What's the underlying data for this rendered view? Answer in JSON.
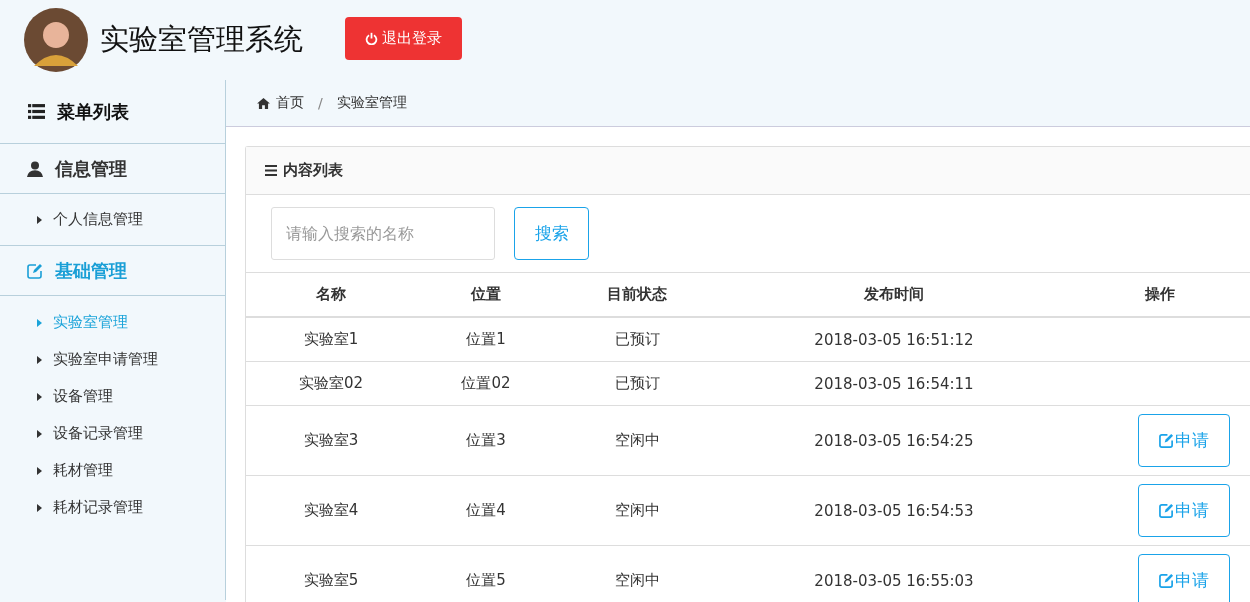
{
  "header": {
    "title": "实验室管理系统",
    "logout_button": "退出登录"
  },
  "sidebar": {
    "title": "菜单列表",
    "groups": [
      {
        "label": "信息管理",
        "kind": "user",
        "selected": false,
        "items": [
          {
            "label": "个人信息管理",
            "selected": false
          }
        ]
      },
      {
        "label": "基础管理",
        "kind": "edit",
        "selected": true,
        "items": [
          {
            "label": "实验室管理",
            "selected": true
          },
          {
            "label": "实验室申请管理",
            "selected": false
          },
          {
            "label": "设备管理",
            "selected": false
          },
          {
            "label": "设备记录管理",
            "selected": false
          },
          {
            "label": "耗材管理",
            "selected": false
          },
          {
            "label": "耗材记录管理",
            "selected": false
          }
        ]
      }
    ]
  },
  "breadcrumb": {
    "separator": "/",
    "items": [
      "首页",
      "实验室管理"
    ]
  },
  "panel": {
    "title": "内容列表",
    "search": {
      "placeholder": "请输入搜索的名称",
      "button": "搜索"
    },
    "table": {
      "columns": [
        "名称",
        "位置",
        "目前状态",
        "发布时间",
        "操作"
      ],
      "rows": [
        {
          "cells": [
            "实验室1",
            "位置1",
            "已预订",
            "2018-03-05 16:51:12"
          ]
        },
        {
          "cells": [
            "实验室02",
            "位置02",
            "已预订",
            "2018-03-05 16:54:11"
          ]
        },
        {
          "cells": [
            "实验室3",
            "位置3",
            "空闲中",
            "2018-03-05 16:54:25"
          ],
          "action": "申请"
        },
        {
          "cells": [
            "实验室4",
            "位置4",
            "空闲中",
            "2018-03-05 16:54:53"
          ],
          "action": "申请"
        },
        {
          "cells": [
            "实验室5",
            "位置5",
            "空闲中",
            "2018-03-05 16:55:03"
          ],
          "action": "申请"
        }
      ]
    }
  }
}
